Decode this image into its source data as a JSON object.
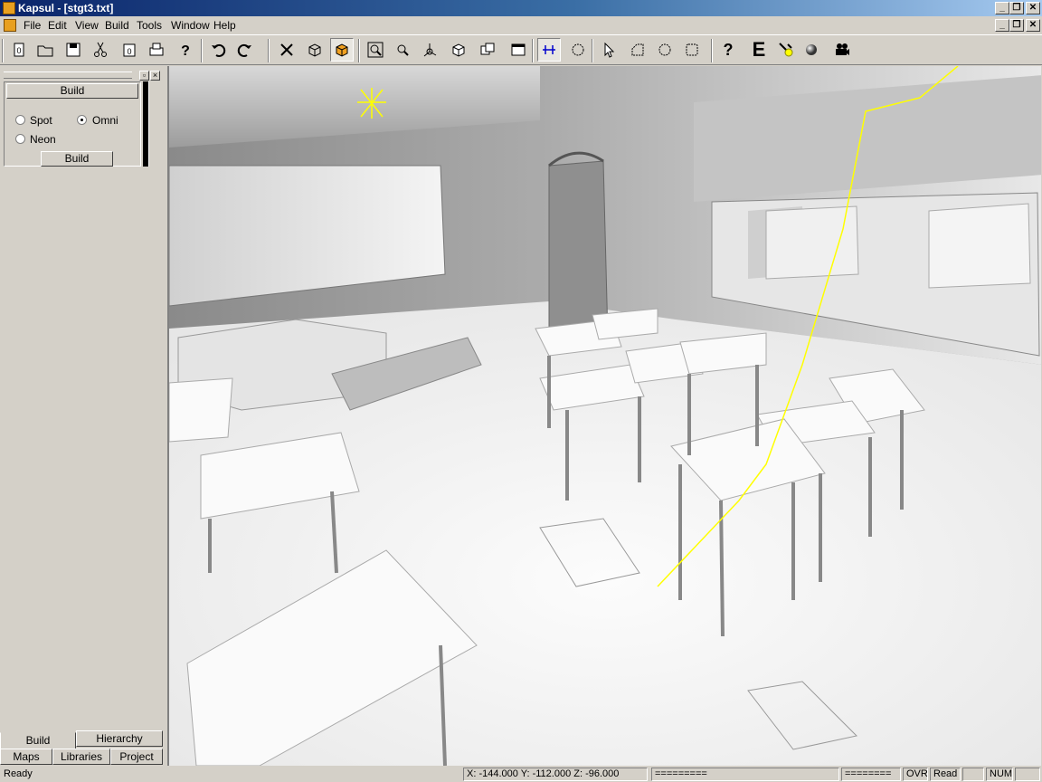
{
  "window": {
    "title": "Kapsul - [stgt3.txt]"
  },
  "menu": [
    "File",
    "Edit",
    "View",
    "Build",
    "Tools",
    "Window",
    "Help"
  ],
  "toolbar": {
    "icons": [
      "new-file-icon",
      "open-folder-icon",
      "save-icon",
      "cut-icon",
      "paste-icon",
      "print-icon",
      "help-cursor-icon",
      "undo-icon",
      "redo-icon",
      "tools-icon",
      "wireframe-cube-icon",
      "solid-cube-icon",
      "zoom-extents-icon",
      "zoom-icon",
      "axis-icon",
      "box-icon",
      "group-icon",
      "window-icon",
      "vertex-select-icon",
      "circle-select-icon",
      "pointer-icon",
      "polygon-select-icon",
      "circle-dotted-icon",
      "square-dotted-icon",
      "help-icon",
      "entity-icon",
      "light-icon",
      "sphere-icon",
      "camera-icon"
    ],
    "help_glyph": "?",
    "entity_glyph": "E"
  },
  "left_panel": {
    "header_button": "Build",
    "radio_spot": "Spot",
    "radio_omni": "Omni",
    "radio_neon": "Neon",
    "selected": "Omni",
    "build_button": "Build",
    "tabs_top": [
      "Build",
      "Hierarchy"
    ],
    "tabs_bottom": [
      "Maps",
      "Libraries",
      "Project"
    ],
    "active_tab": "Build"
  },
  "status": {
    "ready": "Ready",
    "coords": "X: -144.000 Y: -112.000 Z: -96.000",
    "bar1": "=========",
    "bar2": "========",
    "ovr": "OVR",
    "read": "Read",
    "num": "NUM"
  }
}
